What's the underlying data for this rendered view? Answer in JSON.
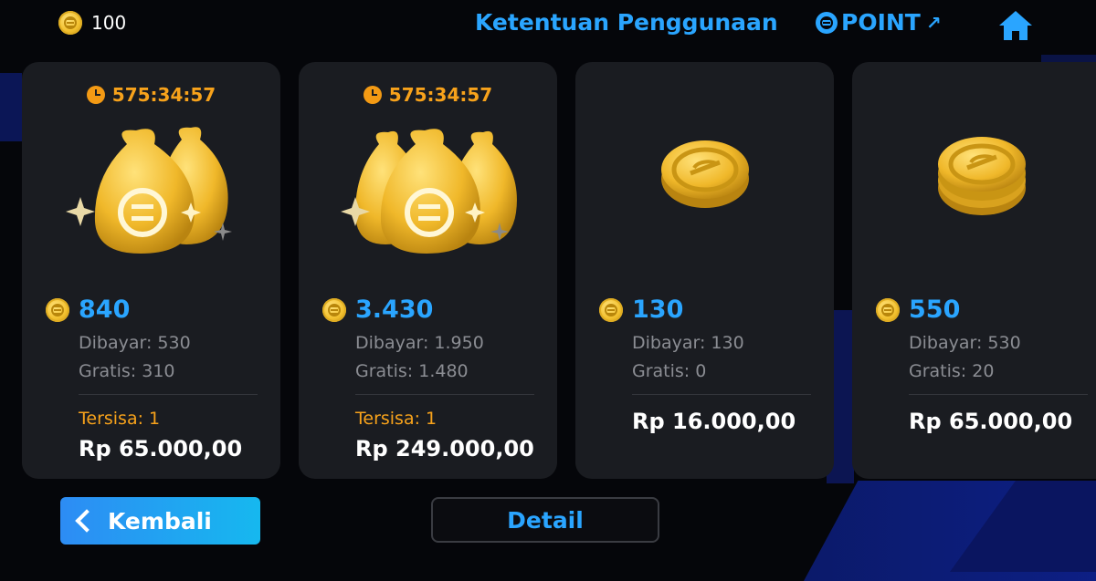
{
  "header": {
    "balance": "100",
    "terms_label": "Ketentuan Penggunaan",
    "point_label": "POINT",
    "point_arrow": "↗"
  },
  "cards": [
    {
      "timer": "575:34:57",
      "art": "three-money-bags-icon",
      "amount": "840",
      "paid": "Dibayar: 530",
      "free": "Gratis: 310",
      "remaining": "Tersisa: 1",
      "price": "Rp 65.000,00"
    },
    {
      "timer": "575:34:57",
      "art": "four-money-bags-icon",
      "amount": "3.430",
      "paid": "Dibayar: 1.950",
      "free": "Gratis: 1.480",
      "remaining": "Tersisa: 1",
      "price": "Rp 249.000,00"
    },
    {
      "timer": "",
      "art": "single-coin-icon",
      "amount": "130",
      "paid": "Dibayar: 130",
      "free": "Gratis: 0",
      "remaining": "",
      "price": "Rp 16.000,00"
    },
    {
      "timer": "",
      "art": "coin-stack-icon",
      "amount": "550",
      "paid": "Dibayar: 530",
      "free": "Gratis: 20",
      "remaining": "",
      "price": "Rp 65.000,00"
    }
  ],
  "footer": {
    "back_label": "Kembali",
    "detail_label": "Detail"
  },
  "colors": {
    "accent_blue": "#2aa5ff",
    "timer_orange": "#f7a21b",
    "card_bg": "#1a1c21",
    "gold": "#f3c12f"
  }
}
